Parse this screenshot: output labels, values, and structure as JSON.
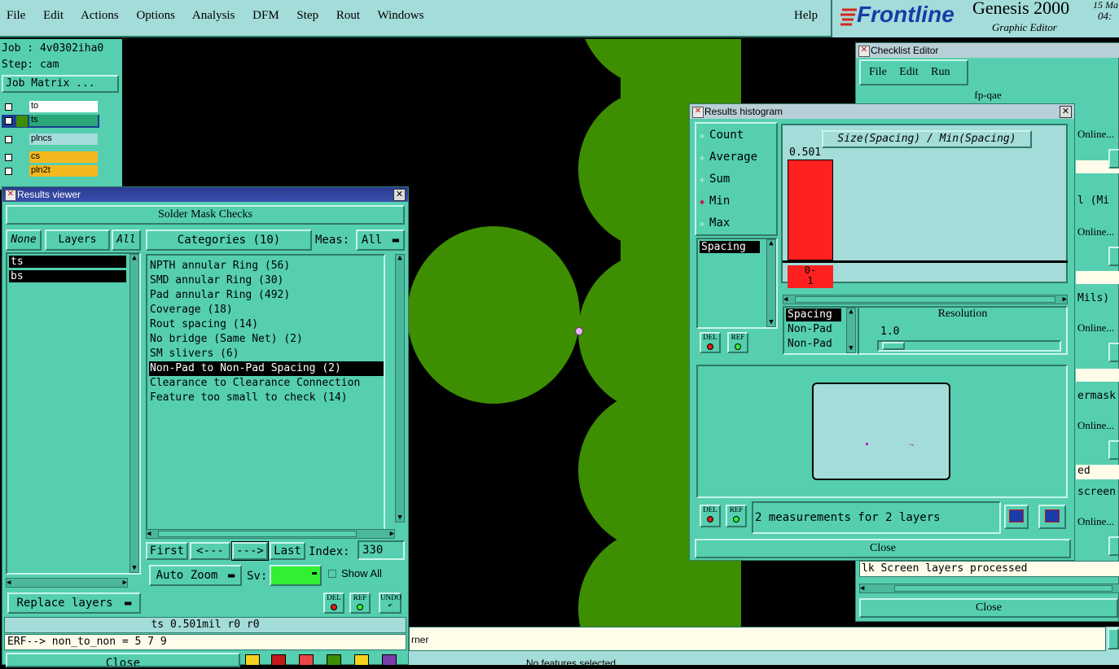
{
  "menubar": {
    "items": [
      "File",
      "Edit",
      "Actions",
      "Options",
      "Analysis",
      "DFM",
      "Step",
      "Rout",
      "Windows"
    ],
    "help": "Help"
  },
  "brand": {
    "logo": "Frontline",
    "product": "Genesis 2000",
    "subtitle": "Graphic Editor",
    "date": "15 Ma",
    "time": "04:"
  },
  "job_panel": {
    "job": "Job : 4v0302iha0",
    "step": "Step: cam",
    "matrix_button": "Job Matrix ..."
  },
  "layers": [
    {
      "name": "to",
      "color": "#ffffff"
    },
    {
      "name": "ts",
      "color": "#2ba87a"
    },
    {
      "name": "plncs",
      "color": "#a3dcd9"
    },
    {
      "name": "cs",
      "color": "#f4b81f"
    },
    {
      "name": "pln2t",
      "color": "#f4b81f"
    }
  ],
  "results_viewer": {
    "title": "Results viewer",
    "header": "Solder Mask Checks",
    "none_btn": "None",
    "layers_btn": "Layers",
    "all_btn": "All",
    "categories_btn": "Categories (10)",
    "meas_label": "Meas:",
    "meas_value": "All",
    "layer_list": [
      "ts",
      "bs"
    ],
    "categories": [
      "NPTH annular Ring (56)",
      "SMD annular Ring (30)",
      "Pad annular Ring (492)",
      "Coverage (18)",
      "Rout spacing (14)",
      "No bridge (Same Net) (2)",
      "SM slivers (6)",
      "Non-Pad to Non-Pad Spacing (2)",
      "Clearance to Clearance Connection",
      "Feature too small to check (14)"
    ],
    "selected_category": 7,
    "first_btn": "First",
    "prev_btn": "<---",
    "next_btn": "--->",
    "last_btn": "Last",
    "index_label": "Index:",
    "index_value": "330",
    "autozoom_btn": "Auto Zoom",
    "sv_label": "Sv:",
    "show_all_label": "Show All",
    "replace_btn": "Replace layers",
    "del_label": "DEL",
    "ref_label": "REF",
    "undo_label": "UNDO",
    "status_line": "ts 0.501mil  r0  r0",
    "erf_line": "ERF--> non_to_non = 5 7 9",
    "close_btn": "Close"
  },
  "checklist_editor": {
    "title": "Checklist Editor",
    "menu": [
      "File",
      "Edit",
      "Run"
    ],
    "name": "fp-qae",
    "online_label": "Online...",
    "row_texts": [
      "l (Mi",
      "Mils)",
      "ermask",
      "ed",
      "screen"
    ],
    "status": "lk Screen layers processed",
    "close_btn": "Close"
  },
  "histogram": {
    "title": "Results histogram",
    "modes": [
      "Count",
      "Average",
      "Sum",
      "Min",
      "Max"
    ],
    "selected_mode": "Min",
    "chart_title": "Size(Spacing) / Min(Spacing)",
    "bar_value": "0.501",
    "bin_label_top": "0-",
    "bin_label_bottom": "1",
    "meas_list": [
      "Spacing"
    ],
    "lower_list": [
      "Spacing",
      "Non-Pad",
      "Non-Pad"
    ],
    "resolution_label": "Resolution",
    "resolution_value": "1.0",
    "measurements_text": "2 measurements for 2 layers",
    "close_btn": "Close",
    "del_label": "DEL",
    "ref_label": "REF"
  },
  "bottom": {
    "corner_text": "rner",
    "status": "No features selected"
  },
  "colors": {
    "panel": "#55cfb0",
    "pale": "#a3dcd9",
    "copper": "#3d8e00",
    "histogram_bar": "#ff2020",
    "sv_swatch": "#33ee33"
  }
}
